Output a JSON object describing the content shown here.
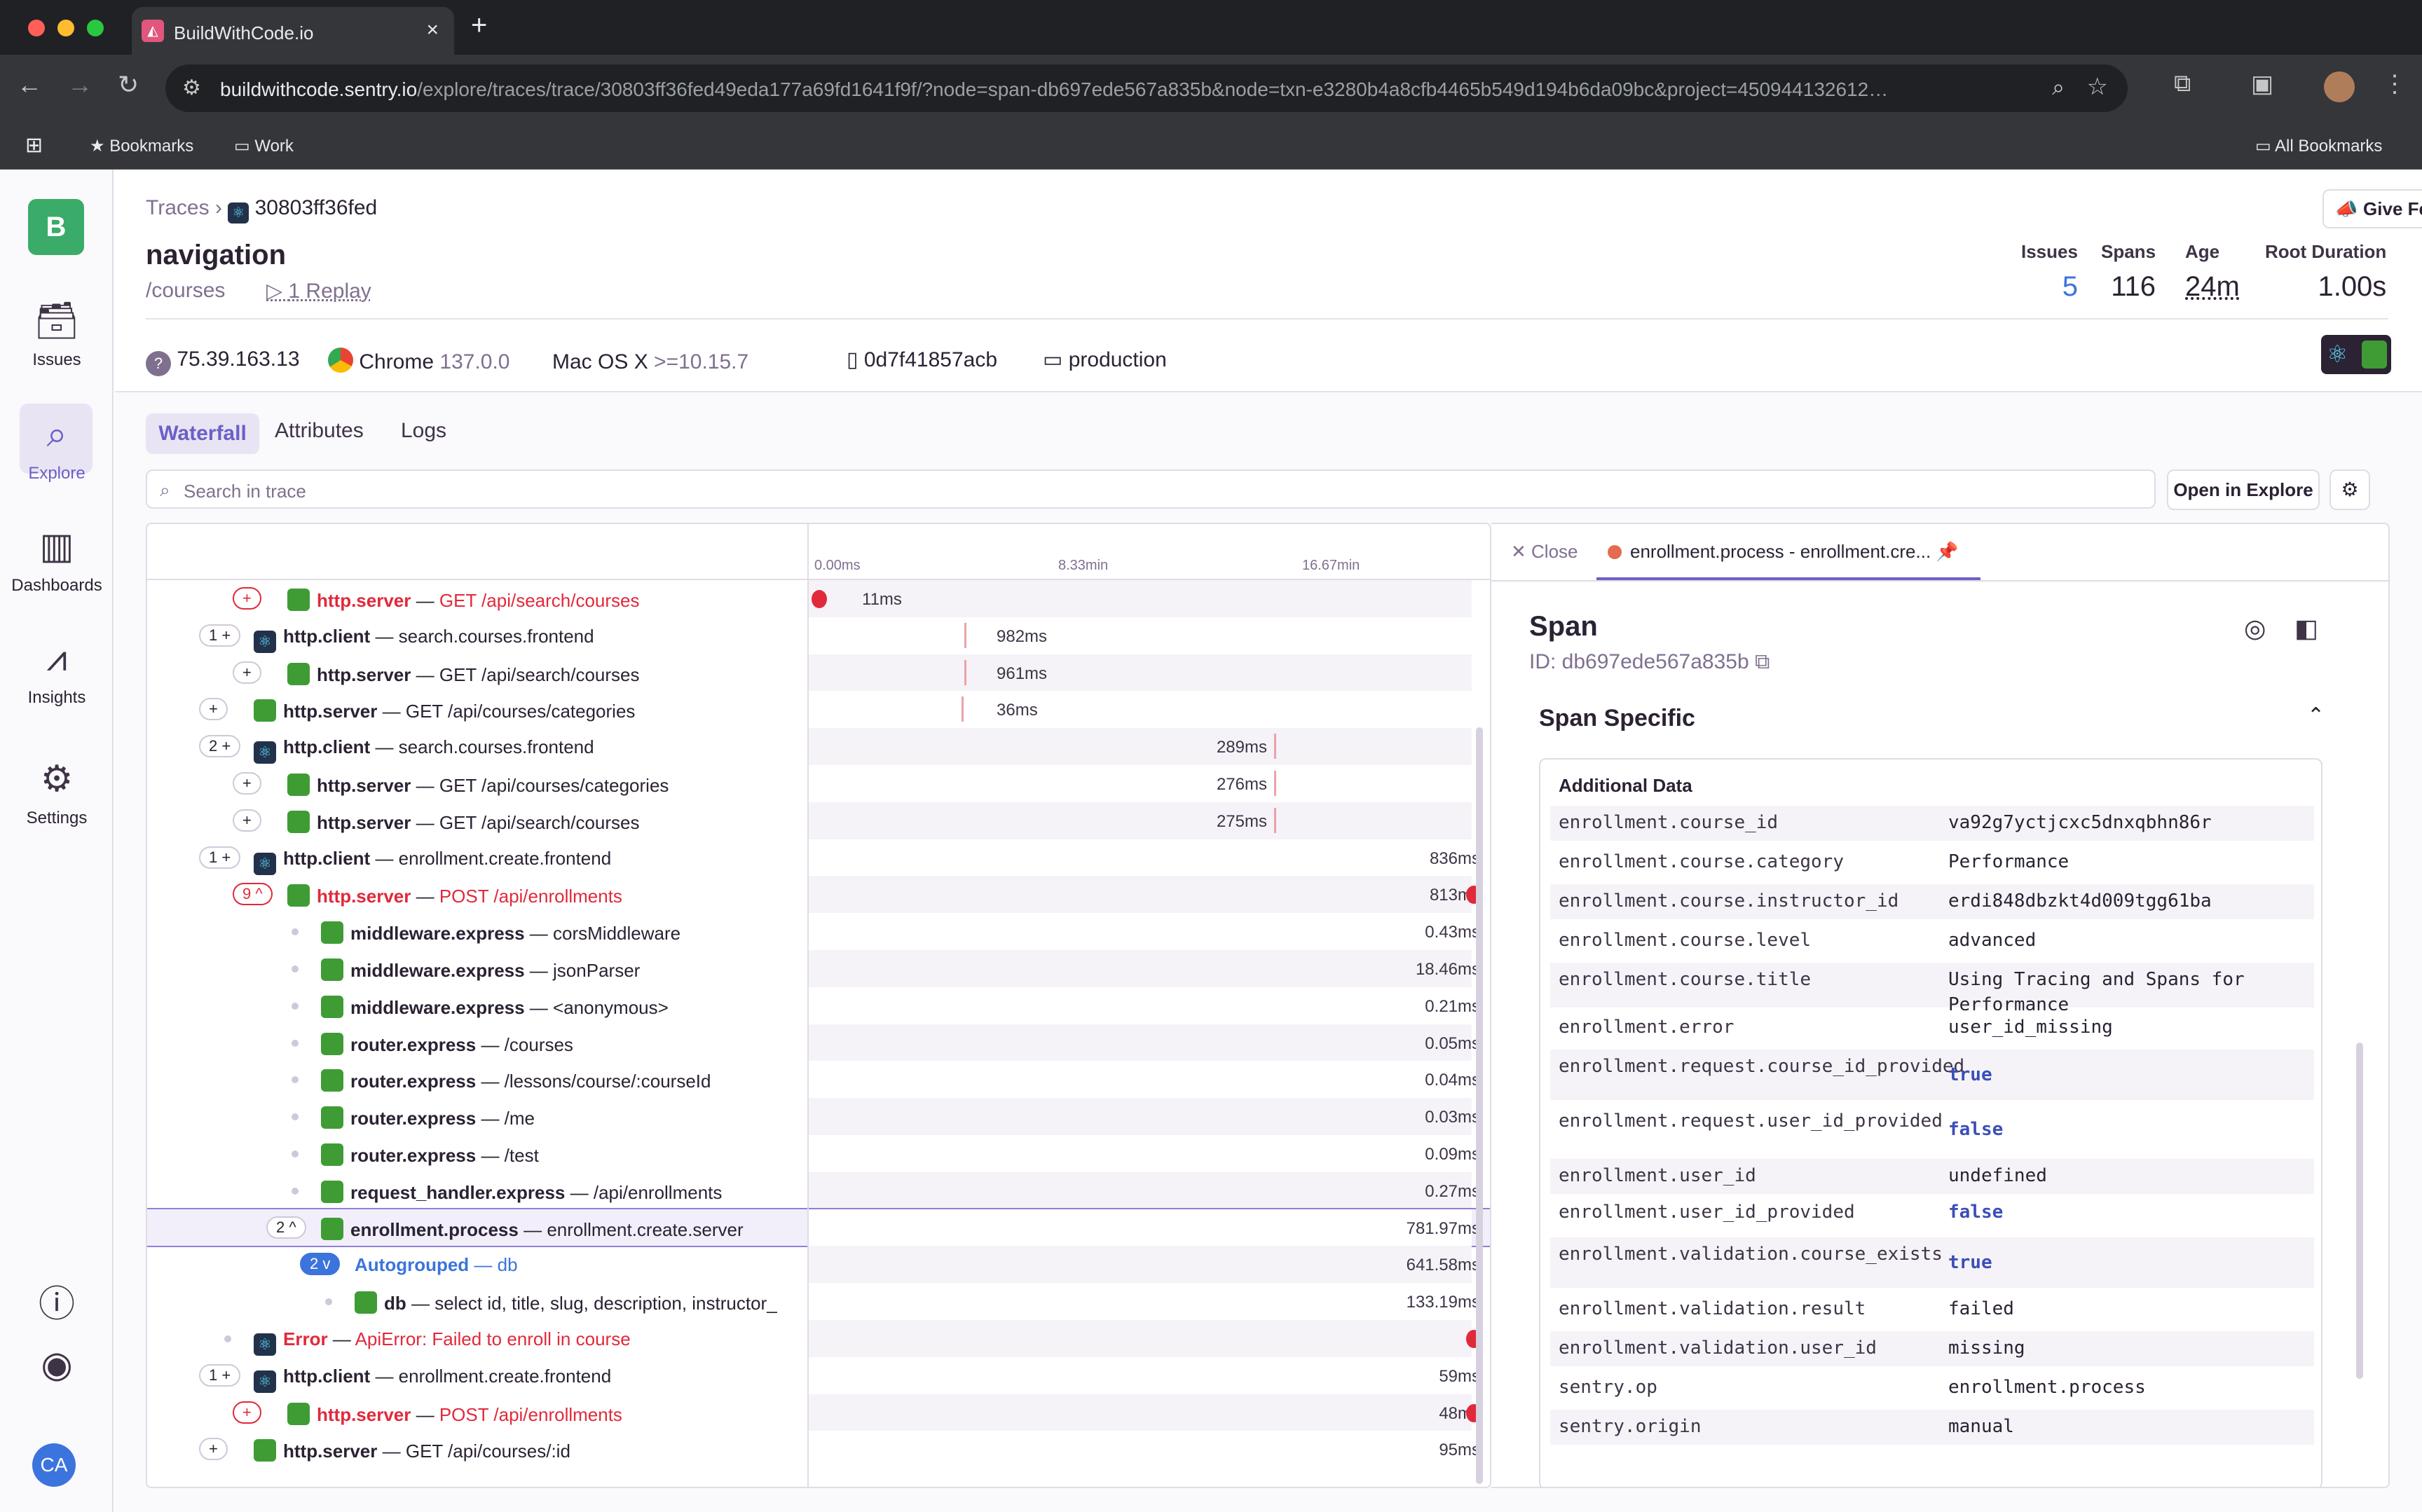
{
  "browser": {
    "tab_title": "BuildWithCode.io",
    "url_host": "buildwithcode.sentry.io",
    "url_path": "/explore/traces/trace/30803ff36fed49eda177a69fd1641f9f/?node=span-db697ede567a835b&node=txn-e3280b4a8cfb4465b549d194b6da09bc&project=450944132612…",
    "bookmarks": [
      "Bookmarks",
      "Work"
    ],
    "all_bookmarks": "All Bookmarks"
  },
  "sidebar": {
    "org_initial": "B",
    "items": [
      {
        "label": "Issues",
        "icon": "inbox-icon"
      },
      {
        "label": "Explore",
        "icon": "search-icon"
      },
      {
        "label": "Dashboards",
        "icon": "dashboard-icon"
      },
      {
        "label": "Insights",
        "icon": "chart-icon"
      },
      {
        "label": "Settings",
        "icon": "gear-icon"
      }
    ],
    "avatar": "CA"
  },
  "header": {
    "breadcrumb_root": "Traces",
    "trace_id": "30803ff36fed",
    "title": "navigation",
    "route": "/courses",
    "replay": "1 Replay",
    "feedback": "Give Feedback",
    "stats": [
      {
        "label": "Issues",
        "value": "5"
      },
      {
        "label": "Spans",
        "value": "116"
      },
      {
        "label": "Age",
        "value": "24m"
      },
      {
        "label": "Root Duration",
        "value": "1.00s"
      }
    ],
    "meta": {
      "ip": "75.39.163.13",
      "browser": "Chrome",
      "browser_ver": "137.0.0",
      "os": "Mac OS X",
      "os_ver": ">=10.15.7",
      "device": "0d7f41857acb",
      "env": "production"
    }
  },
  "tabs": {
    "waterfall": "Waterfall",
    "attributes": "Attributes",
    "logs": "Logs"
  },
  "search": {
    "placeholder": "Search in trace"
  },
  "open_explore": "Open in Explore",
  "ticks": [
    "0.00ms",
    "8.33min",
    "16.67min"
  ],
  "waterfall": [
    {
      "count": "+",
      "op": "http.server",
      "desc": "GET /api/search/courses",
      "dur": "11ms",
      "err": true,
      "icon": "node",
      "indent": 1
    },
    {
      "count": "1 +",
      "op": "http.client",
      "desc": "search.courses.frontend",
      "dur": "982ms",
      "icon": "react",
      "indent": 0
    },
    {
      "count": "+",
      "op": "http.server",
      "desc": "GET /api/search/courses",
      "dur": "961ms",
      "icon": "node",
      "indent": 1
    },
    {
      "count": "+",
      "op": "http.server",
      "desc": "GET /api/courses/categories",
      "dur": "36ms",
      "icon": "node",
      "indent": 0
    },
    {
      "count": "2 +",
      "op": "http.client",
      "desc": "search.courses.frontend",
      "dur": "289ms",
      "icon": "react",
      "indent": 0
    },
    {
      "count": "+",
      "op": "http.server",
      "desc": "GET /api/courses/categories",
      "dur": "276ms",
      "icon": "node",
      "indent": 1
    },
    {
      "count": "+",
      "op": "http.server",
      "desc": "GET /api/search/courses",
      "dur": "275ms",
      "icon": "node",
      "indent": 1
    },
    {
      "count": "1 +",
      "op": "http.client",
      "desc": "enrollment.create.frontend",
      "dur": "836ms",
      "icon": "react",
      "indent": 0
    },
    {
      "count": "9 ^",
      "op": "http.server",
      "desc": "POST /api/enrollments",
      "dur": "813ms",
      "err": true,
      "icon": "node",
      "indent": 1
    },
    {
      "count": "",
      "op": "middleware.express",
      "desc": "corsMiddleware",
      "dur": "0.43ms",
      "icon": "node",
      "indent": 2
    },
    {
      "count": "",
      "op": "middleware.express",
      "desc": "jsonParser",
      "dur": "18.46ms",
      "icon": "node",
      "indent": 2
    },
    {
      "count": "",
      "op": "middleware.express",
      "desc": "<anonymous>",
      "dur": "0.21ms",
      "icon": "node",
      "indent": 2
    },
    {
      "count": "",
      "op": "router.express",
      "desc": "/courses",
      "dur": "0.05ms",
      "icon": "node",
      "indent": 2
    },
    {
      "count": "",
      "op": "router.express",
      "desc": "/lessons/course/:courseId",
      "dur": "0.04ms",
      "icon": "node",
      "indent": 2
    },
    {
      "count": "",
      "op": "router.express",
      "desc": "/me",
      "dur": "0.03ms",
      "icon": "node",
      "indent": 2
    },
    {
      "count": "",
      "op": "router.express",
      "desc": "/test",
      "dur": "0.09ms",
      "icon": "node",
      "indent": 2
    },
    {
      "count": "",
      "op": "request_handler.express",
      "desc": "/api/enrollments",
      "dur": "0.27ms",
      "icon": "node",
      "indent": 2
    },
    {
      "count": "2 ^",
      "op": "enrollment.process",
      "desc": "enrollment.create.server",
      "dur": "781.97ms",
      "icon": "node",
      "indent": 2,
      "selected": true
    },
    {
      "count": "2 v",
      "op": "Autogrouped",
      "desc": "db",
      "dur": "641.58ms",
      "icon": "",
      "indent": 3,
      "auto": true
    },
    {
      "count": "",
      "op": "db",
      "desc": "select id, title, slug, description, instructor_",
      "dur": "133.19ms",
      "icon": "node",
      "indent": 3
    },
    {
      "count": "",
      "op": "Error",
      "desc": "ApiError: Failed to enroll in course",
      "dur": "",
      "err": true,
      "icon": "react",
      "indent": 0
    },
    {
      "count": "1 +",
      "op": "http.client",
      "desc": "enrollment.create.frontend",
      "dur": "59ms",
      "icon": "react",
      "indent": 0
    },
    {
      "count": "+",
      "op": "http.server",
      "desc": "POST /api/enrollments",
      "dur": "48ms",
      "err": true,
      "icon": "node",
      "indent": 1
    },
    {
      "count": "+",
      "op": "http.server",
      "desc": "GET /api/courses/:id",
      "dur": "95ms",
      "icon": "node",
      "indent": 0
    }
  ],
  "detail": {
    "close": "Close",
    "tab_label": "enrollment.process - enrollment.cre...",
    "title": "Span",
    "span_id": "ID: db697ede567a835b",
    "section": "Span Specific",
    "additional": "Additional Data",
    "attrs": [
      {
        "k": "enrollment.course_id",
        "v": "va92g7yctjcxc5dnxqbhn86r"
      },
      {
        "k": "enrollment.course.category",
        "v": "Performance"
      },
      {
        "k": "enrollment.course.instructor_id",
        "v": "erdi848dbzkt4d009tgg61ba"
      },
      {
        "k": "enrollment.course.level",
        "v": "advanced"
      },
      {
        "k": "enrollment.course.title",
        "v": "Using Tracing and Spans for Performance"
      },
      {
        "k": "enrollment.error",
        "v": "user_id_missing"
      },
      {
        "k": "enrollment.request.course_id_provided",
        "v": "true",
        "bool": true
      },
      {
        "k": "enrollment.request.user_id_provided",
        "v": "false",
        "bool": true
      },
      {
        "k": "enrollment.user_id",
        "v": "undefined"
      },
      {
        "k": "enrollment.user_id_provided",
        "v": "false",
        "bool": true
      },
      {
        "k": "enrollment.validation.course_exists",
        "v": "true",
        "bool": true
      },
      {
        "k": "enrollment.validation.result",
        "v": "failed"
      },
      {
        "k": "enrollment.validation.user_id",
        "v": "missing"
      },
      {
        "k": "sentry.op",
        "v": "enrollment.process"
      },
      {
        "k": "sentry.origin",
        "v": "manual"
      }
    ]
  },
  "colors": {
    "accent": "#6c5fc7",
    "error": "#e1293b",
    "link": "#3c74dd"
  }
}
